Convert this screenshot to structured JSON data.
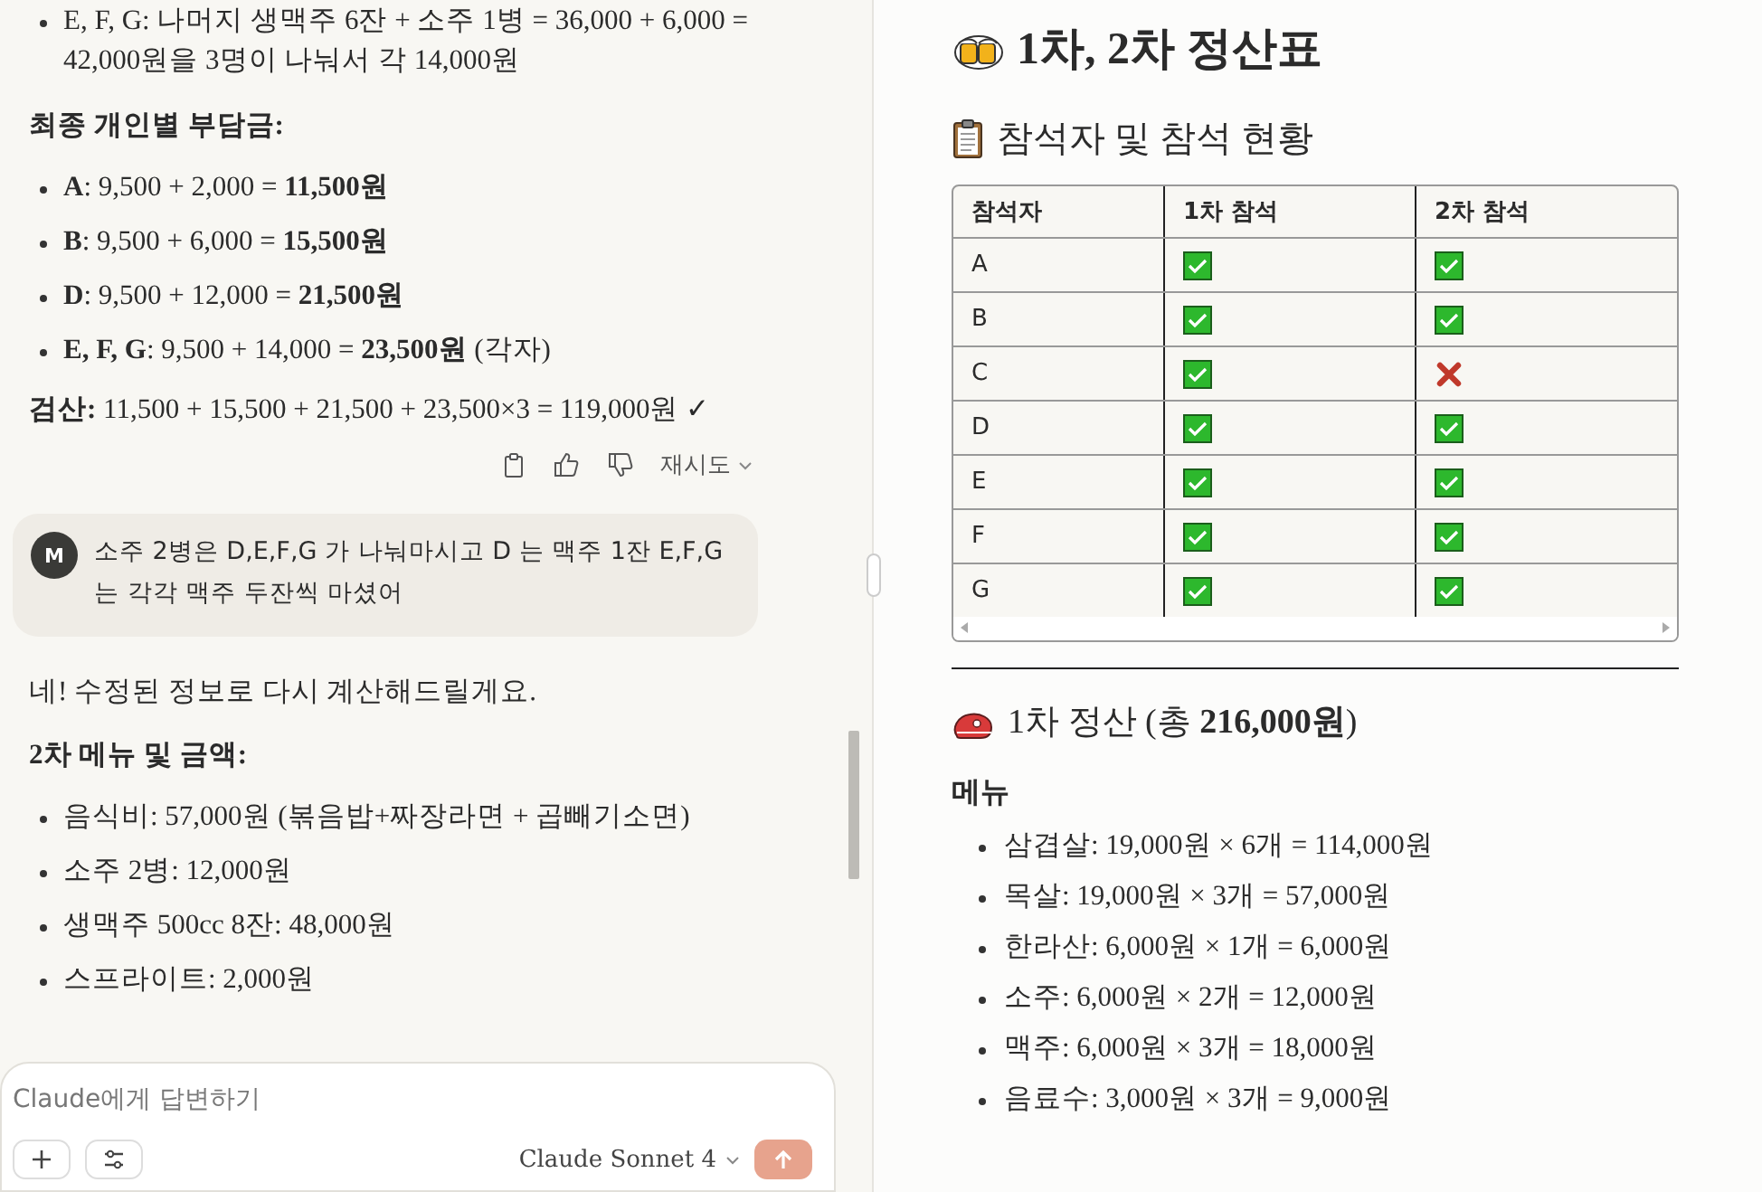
{
  "chat": {
    "blocks": [
      {
        "kind": "bullet",
        "text": "E, F, G: 나머지 생맥주 6잔 + 소주 1병 = 36,000 + 6,000 = 42,000원을 3명이 나눠서 각 14,000원"
      },
      {
        "kind": "heading",
        "text": "최종 개인별 부담금:"
      },
      {
        "kind": "bullet",
        "text": "**A**: 9,500 + 2,000 = **11,500원**"
      },
      {
        "kind": "bullet",
        "text": "**B**: 9,500 + 6,000 = **15,500원**"
      },
      {
        "kind": "bullet",
        "text": "**D**: 9,500 + 12,000 = **21,500원**"
      },
      {
        "kind": "bullet",
        "text": "**E, F, G**: 9,500 + 14,000 = **23,500원** (각자)"
      },
      {
        "kind": "paragraph",
        "text": "**검산:** 11,500 + 15,500 + 21,500 + 23,500×3 = 119,000원 ✓"
      },
      {
        "kind": "actions",
        "retry": "재시도"
      },
      {
        "kind": "user_message",
        "avatar": "M",
        "text": "소주 2병은  D,E,F,G 가 나눠마시고 D 는 맥주 1잔  E,F,G 는 각각 맥주 두잔씩 마셨어"
      },
      {
        "kind": "paragraph",
        "text": "네! 수정된 정보로 다시 계산해드릴게요."
      },
      {
        "kind": "heading",
        "text": "2차 메뉴 및 금액:"
      },
      {
        "kind": "bullet",
        "text": "음식비: 57,000원 (볶음밥+짜장라면 + 곱빼기소면)"
      },
      {
        "kind": "bullet",
        "text": "소주 2병: 12,000원"
      },
      {
        "kind": "bullet",
        "text": "생맥주 500cc 8잔: 48,000원"
      },
      {
        "kind": "bullet",
        "text": "스프라이트: 2,000원"
      }
    ],
    "composer": {
      "placeholder": "Claude에게 답변하기",
      "model": "Claude Sonnet 4"
    }
  },
  "artifact": {
    "title": "1차, 2차 정산표",
    "attendance": {
      "heading": "참석자 및 참석 현황",
      "columns": [
        "참석자",
        "1차 참석",
        "2차 참석"
      ],
      "rows": [
        {
          "name": "A",
          "first": true,
          "second": true
        },
        {
          "name": "B",
          "first": true,
          "second": true
        },
        {
          "name": "C",
          "first": true,
          "second": false
        },
        {
          "name": "D",
          "first": true,
          "second": true
        },
        {
          "name": "E",
          "first": true,
          "second": true
        },
        {
          "name": "F",
          "first": true,
          "second": true
        },
        {
          "name": "G",
          "first": true,
          "second": true
        }
      ]
    },
    "first_round": {
      "heading": "1차 정산 (총 **216,000원**)",
      "menu_heading": "메뉴",
      "items": [
        "삼겹살: 19,000원 × 6개 = 114,000원",
        "목살: 19,000원 × 3개 = 57,000원",
        "한라산: 6,000원 × 1개 = 6,000원",
        "소주: 6,000원 × 2개 = 12,000원",
        "맥주: 6,000원 × 3개 = 18,000원",
        "음료수: 3,000원 × 3개 = 9,000원"
      ]
    }
  }
}
